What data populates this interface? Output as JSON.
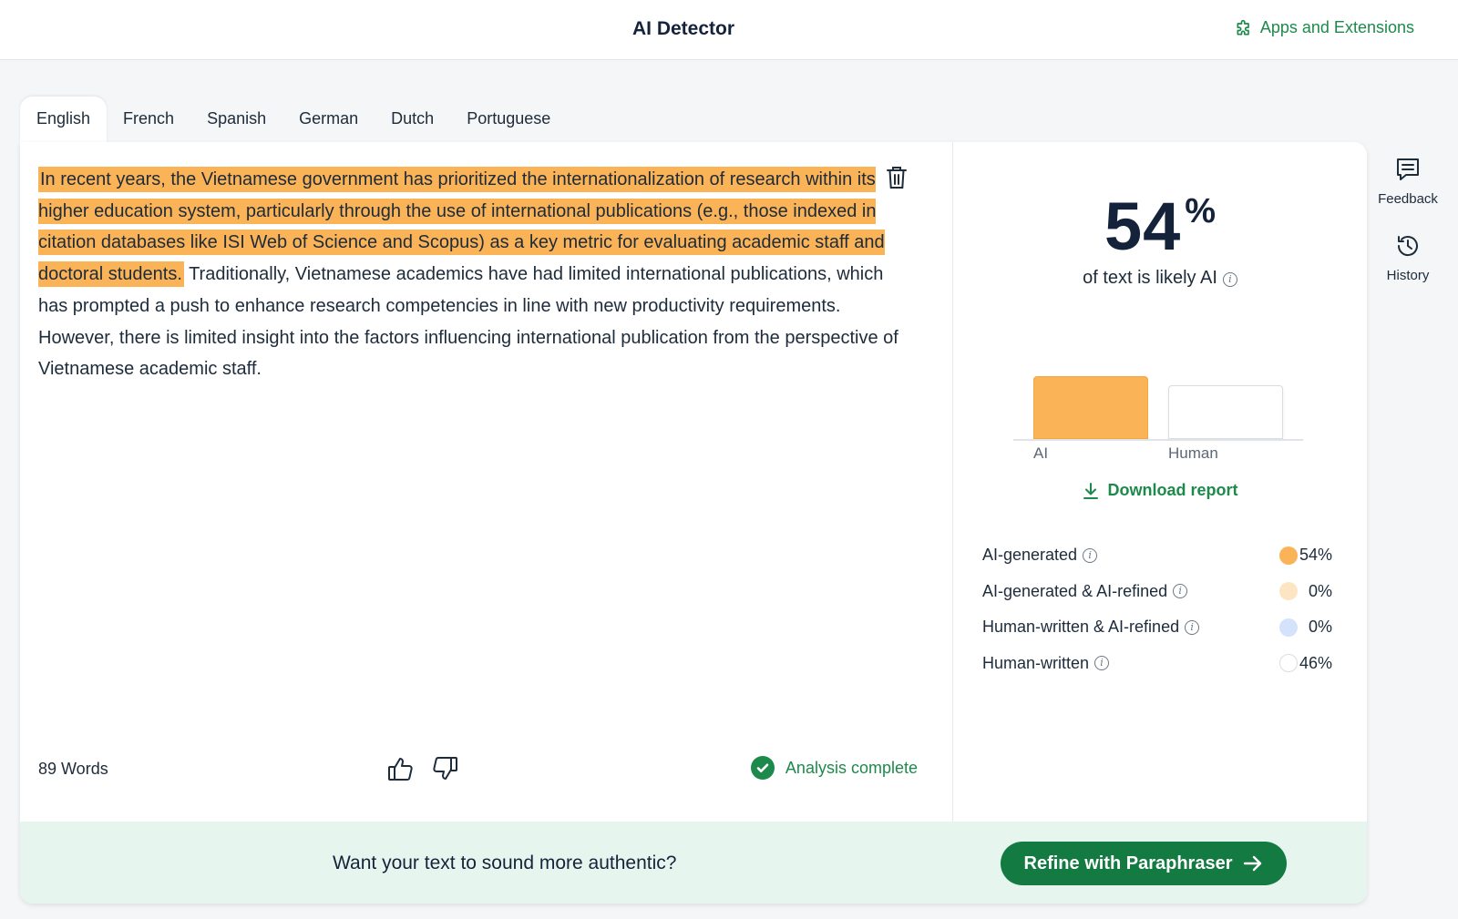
{
  "header": {
    "title": "AI Detector",
    "apps_link": "Apps and Extensions"
  },
  "tabs": [
    {
      "label": "English",
      "active": true
    },
    {
      "label": "French",
      "active": false
    },
    {
      "label": "Spanish",
      "active": false
    },
    {
      "label": "German",
      "active": false
    },
    {
      "label": "Dutch",
      "active": false
    },
    {
      "label": "Portuguese",
      "active": false
    }
  ],
  "editor": {
    "highlighted_text": "In recent years, the Vietnamese government has prioritized the internationalization of research within its higher education system, particularly through the use of international publications (e.g., those indexed in citation databases like ISI Web of Science and Scopus) as a key metric for evaluating academic staff and doctoral students.",
    "plain_text": " Traditionally, Vietnamese academics have had limited international publications, which has prompted a push to enhance research competencies in line with new productivity requirements. However, there is limited insight into the factors influencing international publication from the perspective of Vietnamese academic staff.",
    "highlight_color": "#fbb357",
    "word_count": "89 Words",
    "status": "Analysis complete"
  },
  "results": {
    "percent": "54",
    "percent_sign": "%",
    "likely_label": "of text is likely AI",
    "chart": {
      "ai_label": "AI",
      "human_label": "Human",
      "ai_value": 0.54,
      "human_value": 0.46
    },
    "download_label": "Download report",
    "breakdown": [
      {
        "label": "AI-generated",
        "value": "54%",
        "color": "#fbb357"
      },
      {
        "label": "AI-generated & AI-refined",
        "value": "0%",
        "color": "#fde5c4"
      },
      {
        "label": "Human-written & AI-refined",
        "value": "0%",
        "color": "#d4e2fb"
      },
      {
        "label": "Human-written",
        "value": "46%",
        "color": "#ffffff"
      }
    ]
  },
  "banner": {
    "text": "Want your text to sound more authentic?",
    "button_label": "Refine with Paraphraser"
  },
  "sidebar": {
    "feedback_label": "Feedback",
    "history_label": "History"
  },
  "colors": {
    "accent_green": "#137a41",
    "link_green": "#1d8a4b",
    "ai_orange": "#fbb357"
  }
}
